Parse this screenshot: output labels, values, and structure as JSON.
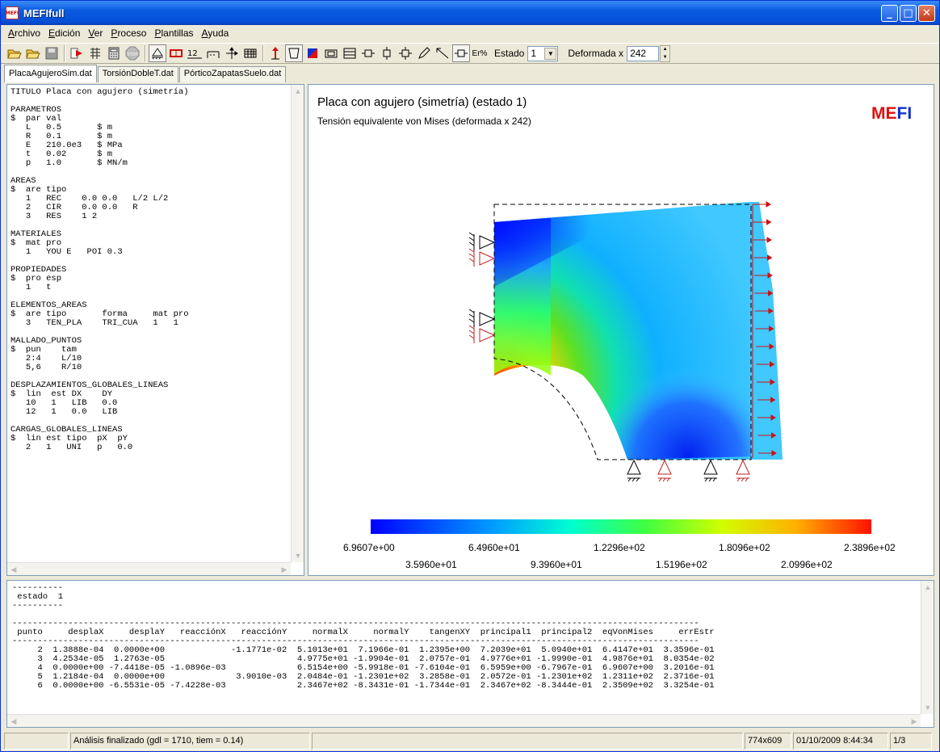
{
  "window": {
    "title": "MEFIfull",
    "icon": "mefi-app-icon"
  },
  "menu": [
    {
      "u": "A",
      "rest": "rchivo"
    },
    {
      "u": "E",
      "rest": "dición"
    },
    {
      "u": "V",
      "rest": "er"
    },
    {
      "u": "P",
      "rest": "roceso"
    },
    {
      "u": "P",
      "rest": "lantillas"
    },
    {
      "u": "A",
      "rest": "yuda"
    }
  ],
  "toolbar": {
    "estado_label": "Estado",
    "estado_value": "1",
    "deformada_label": "Deformada x",
    "deformada_value": "242",
    "err_label": "Er%"
  },
  "tabs": [
    "PlacaAgujeroSim.dat",
    "TorsiónDobleT.dat",
    "PórticoZapatasSuelo.dat"
  ],
  "editor": {
    "text": "TITULO Placa con agujero (simetría)\n\nPARAMETROS\n$  par val\n   L   0.5       $ m\n   R   0.1       $ m\n   E   210.0e3   $ MPa\n   t   0.02      $ m\n   p   1.0       $ MN/m\n\nAREAS\n$  are tipo\n   1   REC    0.0 0.0   L/2 L/2\n   2   CIR    0.0 0.0   R\n   3   RES    1 2\n\nMATERIALES\n$  mat pro\n   1   YOU E   POI 0.3\n\nPROPIEDADES\n$  pro esp\n   1   t\n\nELEMENTOS_AREAS\n$  are tipo       forma     mat pro\n   3   TEN_PLA    TRI_CUA   1   1\n\nMALLADO_PUNTOS\n$  pun    tam\n   2:4    L/10\n   5,6    R/10\n\nDESPLAZAMIENTOS_GLOBALES_LINEAS\n$  lin  est DX    DY\n   10   1   LIB   0.0\n   12   1   0.0   LIB\n\nCARGAS_GLOBALES_LINEAS\n$  lin est tipo  pX  pY\n   2   1   UNI   p   0.0"
  },
  "viewer": {
    "title": "Placa con agujero (simetría)   (estado 1)",
    "subtitle": "Tensión equivalente von Mises  (deformada x 242)",
    "logo_me": "ME",
    "logo_fi": "FI",
    "colorbar_top": [
      "6.9607e+00",
      "6.4960e+01",
      "1.2296e+02",
      "1.8096e+02",
      "2.3896e+02"
    ],
    "colorbar_bottom": [
      "3.5960e+01",
      "9.3960e+01",
      "1.5196e+02",
      "2.0996e+02"
    ]
  },
  "output": {
    "text": "----------\n estado  1\n----------\n\n---------------------------------------------------------------------------------------------------------------------------------------\n punto     desplaX     desplaY   reacciónX   reacciónY     normalX     normalY    tangenXY  principal1  principal2  eqVonMises     errEstr\n---------------------------------------------------------------------------------------------------------------------------------------\n     2  1.3888e-04  0.0000e+00             -1.1771e-02  5.1013e+01  7.1966e-01  1.2395e+00  7.2039e+01  5.0940e+01  6.4147e+01  3.3596e-01\n     3  4.2534e-05  1.2763e-05                          4.9775e+01 -1.9904e-01  2.0757e-01  4.9776e+01 -1.9990e-01  4.9876e+01  8.0354e-02\n     4  0.0000e+00 -7.4418e-05 -1.0896e-03              6.5154e+00 -5.9918e-01 -7.6104e-01  6.5959e+00 -6.7967e-01  6.9607e+00  3.2016e-01\n     5  1.2184e-04  0.0000e+00              3.9010e-03  2.0484e-01 -1.2301e+02  3.2858e-01  2.0572e-01 -1.2301e+02  1.2311e+02  2.3716e-01\n     6  0.0000e+00 -6.5531e-05 -7.4228e-03              2.3467e+02 -8.3431e-01 -1.7344e-01  2.3467e+02 -8.3444e-01  2.3509e+02  3.3254e-01"
  },
  "status": {
    "message": "Análisis finalizado (gdl = 1710, tiem = 0.14)",
    "size": "774x609",
    "datetime": "01/10/2009 8:44:34",
    "page": "1/3"
  }
}
